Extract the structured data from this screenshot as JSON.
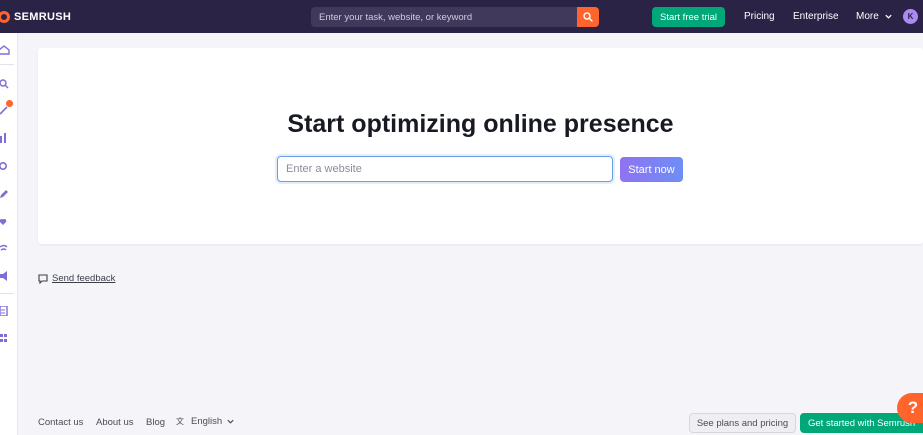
{
  "header": {
    "logo_text": "SEMRUSH",
    "search_placeholder": "Enter your task, website, or keyword",
    "trial_label": "Start free trial",
    "nav": [
      {
        "label": "Pricing"
      },
      {
        "label": "Enterprise"
      },
      {
        "label": "More"
      }
    ],
    "avatar_initial": "K"
  },
  "sidebar": {
    "icons": [
      "home-icon",
      "search-icon",
      "magic-wand-icon",
      "bar-chart-icon",
      "location-pin-icon",
      "edit-icon",
      "heart-chat-icon",
      "broadcast-icon",
      "megaphone-icon",
      "document-icon",
      "apps-icon"
    ]
  },
  "main": {
    "title": "Start optimizing online presence",
    "input_placeholder": "Enter a website",
    "start_label": "Start now"
  },
  "feedback": {
    "label": "Send feedback"
  },
  "footer": {
    "contact": "Contact us",
    "about": "About us",
    "blog": "Blog",
    "language": "English",
    "plans_label": "See plans and pricing",
    "get_started_label": "Get started with Semrush",
    "help_label": "?"
  },
  "colors": {
    "topbar": "#2b2345",
    "accent_orange": "#ff642d",
    "accent_green": "#00a778",
    "accent_purple": "#8f73f2"
  }
}
